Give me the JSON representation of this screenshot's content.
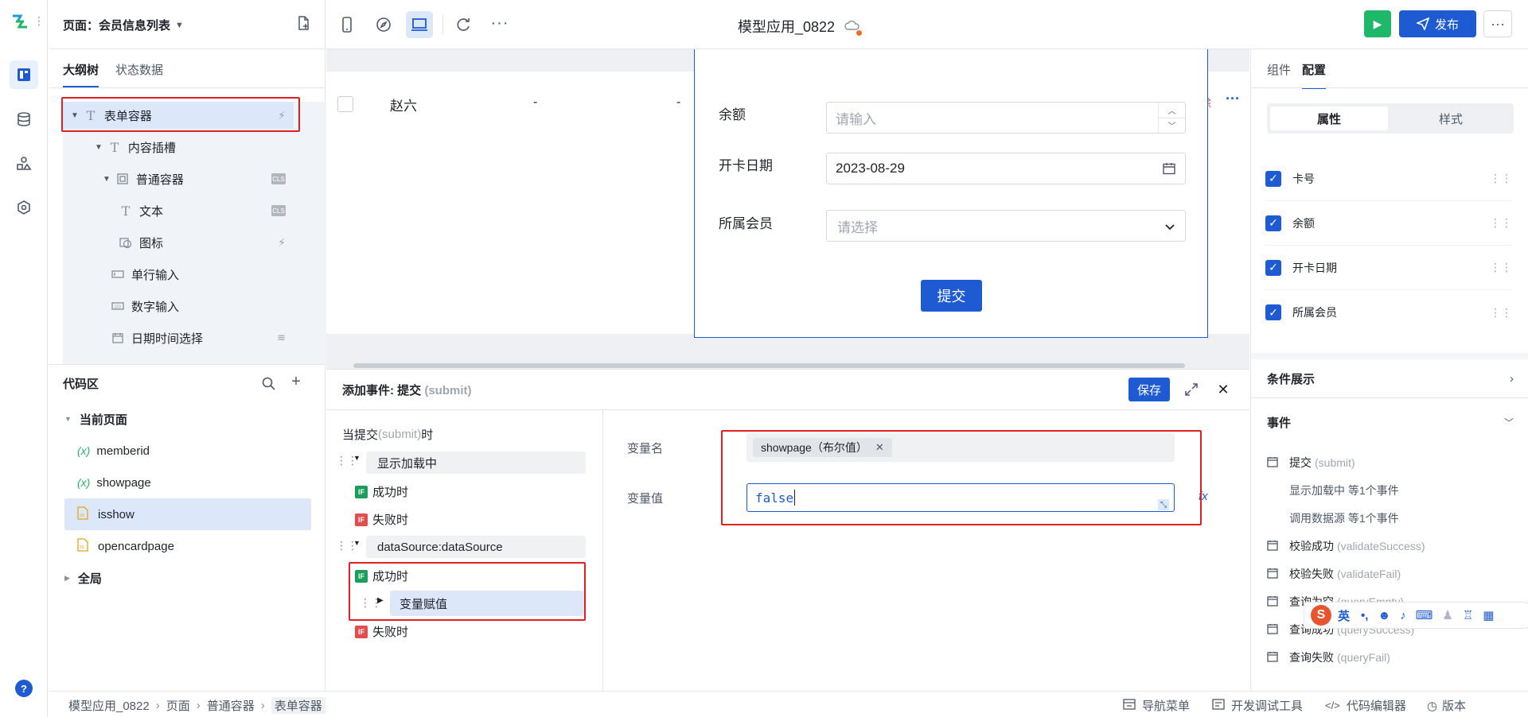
{
  "header": {
    "page_label": "页面：会员信息列表",
    "app_title": "模型应用_0822",
    "publish_label": "发布"
  },
  "left": {
    "tabs": [
      "大纲树",
      "状态数据"
    ],
    "tree": [
      {
        "label": "表单容器",
        "icon": "text-icon",
        "badge": "lightning"
      },
      {
        "label": "内容插槽",
        "icon": "text-icon",
        "badge": ""
      },
      {
        "label": "普通容器",
        "icon": "container-icon",
        "badge": "CLS"
      },
      {
        "label": "文本",
        "icon": "text-icon",
        "badge": "CLS"
      },
      {
        "label": "图标",
        "icon": "image-icon",
        "badge": "lightning"
      },
      {
        "label": "单行输入",
        "icon": "input-icon",
        "badge": ""
      },
      {
        "label": "数字输入",
        "icon": "number-icon",
        "badge": ""
      },
      {
        "label": "日期时间选择",
        "icon": "calendar-icon",
        "badge": "db"
      }
    ],
    "code_title": "代码区",
    "current_page": "当前页面",
    "code_items": [
      {
        "label": "memberid",
        "type": "variable"
      },
      {
        "label": "showpage",
        "type": "variable"
      },
      {
        "label": "isshow",
        "type": "js"
      },
      {
        "label": "opencardpage",
        "type": "js"
      }
    ],
    "global": "全局"
  },
  "canvas": {
    "row": {
      "name": "赵六",
      "c2": "-",
      "c3": "-"
    },
    "form": {
      "fields": [
        {
          "label": "余额",
          "placeholder": "请输入",
          "value": ""
        },
        {
          "label": "开卡日期",
          "placeholder": "",
          "value": "2023-08-29"
        },
        {
          "label": "所属会员",
          "placeholder": "请选择",
          "value": ""
        }
      ],
      "submit": "提交"
    }
  },
  "event": {
    "title_prefix": "添加事件: 提交 ",
    "title_suffix": "(submit)",
    "save": "保存",
    "trigger_prefix": "当提交 ",
    "trigger_mid": "(submit)",
    "trigger_suffix": "时",
    "flow": {
      "loading": "显示加载中",
      "success": "成功时",
      "fail": "失败时",
      "datasource": "dataSource:dataSource",
      "assign": "变量赋值"
    },
    "var_name_label": "变量名",
    "var_tag": "showpage（布尔值）",
    "var_value_label": "变量值",
    "var_value": "false",
    "fx": "fx"
  },
  "right": {
    "tabs": [
      "组件",
      "配置"
    ],
    "subtabs": [
      "属性",
      "样式"
    ],
    "fields": [
      "卡号",
      "余额",
      "开卡日期",
      "所属会员"
    ],
    "cond_title": "条件展示",
    "event_title": "事件",
    "events": [
      {
        "name": "提交",
        "code": "(submit)",
        "icon": true
      },
      {
        "name": "显示加载中 等1个事件",
        "code": "",
        "icon": false
      },
      {
        "name": "调用数据源 等1个事件",
        "code": "",
        "icon": false
      },
      {
        "name": "校验成功",
        "code": "(validateSuccess)",
        "icon": true
      },
      {
        "name": "校验失败",
        "code": "(validateFail)",
        "icon": true
      },
      {
        "name": "查询为空",
        "code": "(queryEmpty)",
        "icon": true
      },
      {
        "name": "查询成功",
        "code": "(querySuccess)",
        "icon": true
      },
      {
        "name": "查询失败",
        "code": "(queryFail)",
        "icon": true
      }
    ]
  },
  "footer": {
    "breadcrumb": [
      "模型应用_0822",
      "页面",
      "普通容器",
      "表单容器"
    ],
    "tools": [
      "导航菜单",
      "开发调试工具",
      "代码编辑器",
      "版本"
    ]
  },
  "ime": {
    "lang": "英"
  },
  "colors": {
    "primary": "#1e5ad1",
    "green": "#1fb86b",
    "danger": "#e02020"
  }
}
